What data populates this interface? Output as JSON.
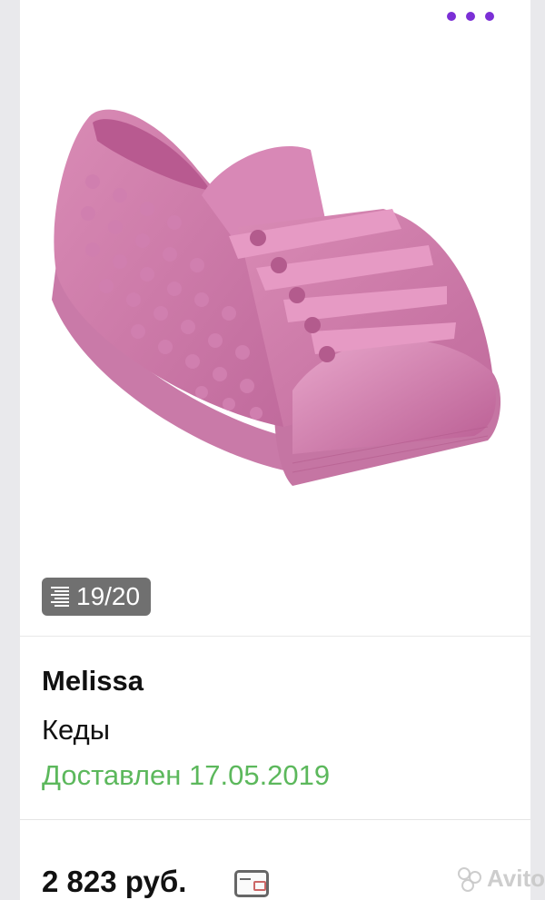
{
  "header": {
    "more_icon": "more-horizontal-icon",
    "accent": "#7b2fd6"
  },
  "gallery": {
    "counter_icon": "list-icon",
    "counter_text": "19/20"
  },
  "item": {
    "brand": "Melissa",
    "category": "Кеды",
    "status": "Доставлен 17.05.2019",
    "status_color": "#5cb85c",
    "price": "2 823 руб.",
    "payment_icon": "credit-card-icon"
  },
  "watermark": {
    "text": "Avito"
  }
}
